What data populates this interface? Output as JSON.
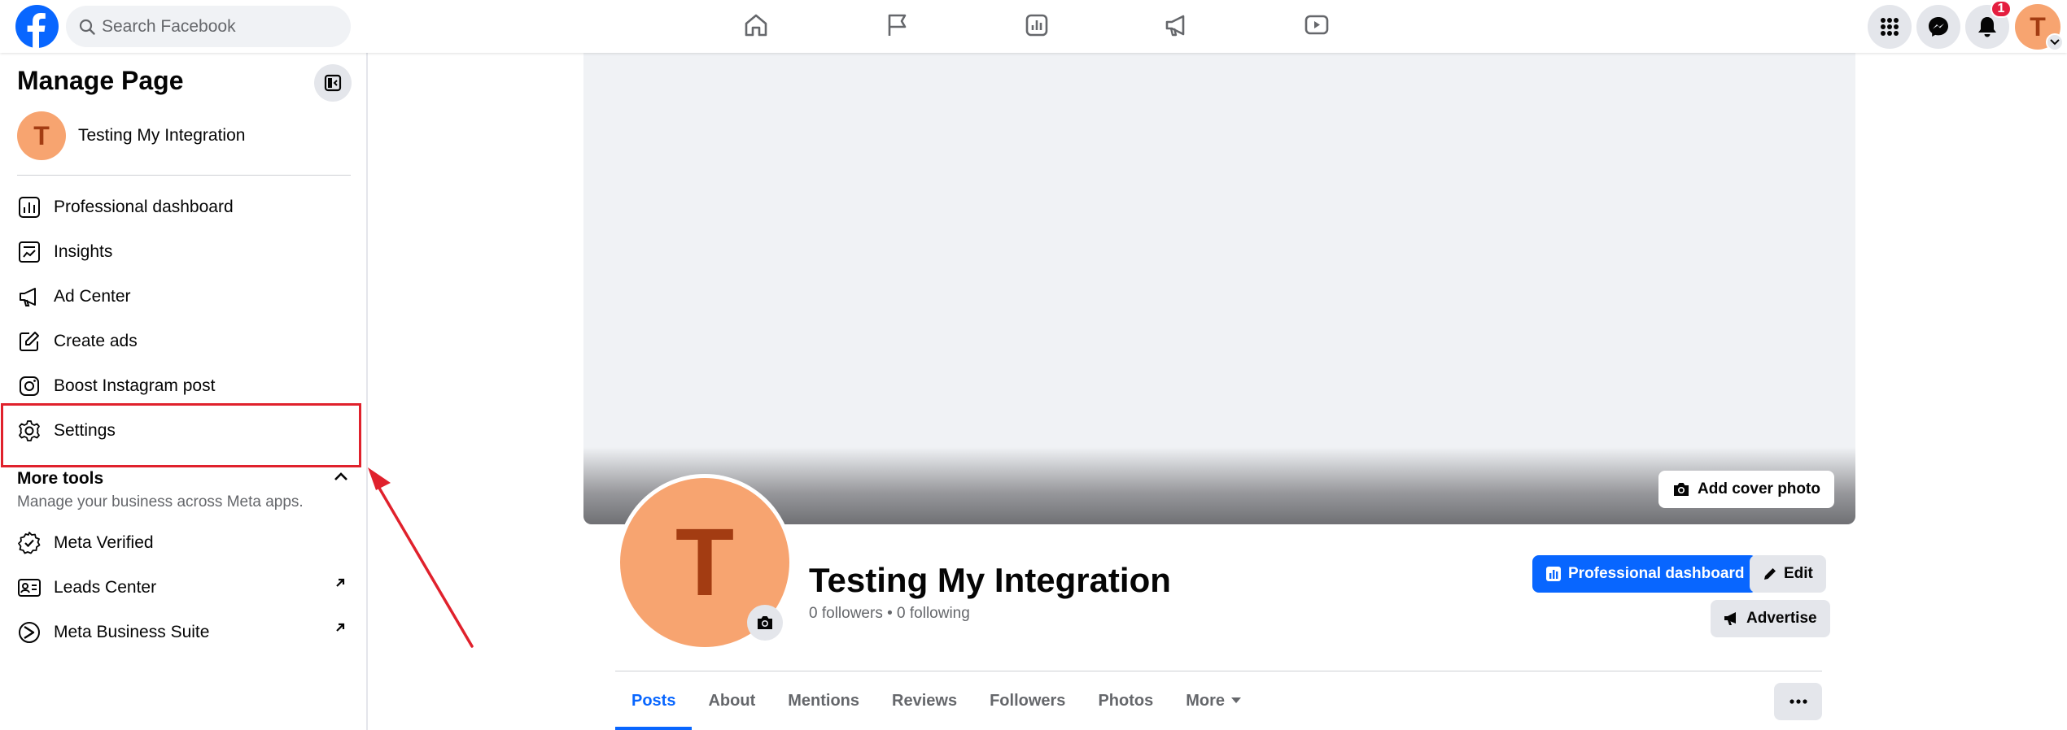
{
  "topbar": {
    "search_placeholder": "Search Facebook",
    "nav_icons": [
      "home-icon",
      "flag-icon",
      "insights-icon",
      "megaphone-icon",
      "video-icon"
    ],
    "notification_count": "1",
    "avatar_initial": "T"
  },
  "sidebar": {
    "title": "Manage Page",
    "page_name": "Testing My Integration",
    "page_initial": "T",
    "items": [
      {
        "label": "Professional dashboard",
        "icon": "dashboard-icon"
      },
      {
        "label": "Insights",
        "icon": "insights-icon"
      },
      {
        "label": "Ad Center",
        "icon": "megaphone-icon"
      },
      {
        "label": "Create ads",
        "icon": "pencil-icon"
      },
      {
        "label": "Boost Instagram post",
        "icon": "instagram-icon"
      },
      {
        "label": "Settings",
        "icon": "gear-icon"
      }
    ],
    "more_tools": {
      "title": "More tools",
      "subtitle": "Manage your business across Meta apps.",
      "items": [
        {
          "label": "Meta Verified",
          "icon": "verified-icon"
        },
        {
          "label": "Leads Center",
          "icon": "leads-icon"
        },
        {
          "label": "Meta Business Suite",
          "icon": "business-suite-icon"
        }
      ]
    }
  },
  "profile": {
    "initial": "T",
    "name": "Testing My Integration",
    "stats": "0 followers • 0 following",
    "add_cover_label": "Add cover photo",
    "professional_dashboard_label": "Professional dashboard",
    "edit_label": "Edit",
    "advertise_label": "Advertise"
  },
  "tabs": [
    "Posts",
    "About",
    "Mentions",
    "Reviews",
    "Followers",
    "Photos",
    "More"
  ],
  "colors": {
    "brand_blue": "#0866ff",
    "avatar_orange": "#f7a470",
    "avatar_letter": "#a33c12",
    "highlight_red": "#e0212c"
  }
}
